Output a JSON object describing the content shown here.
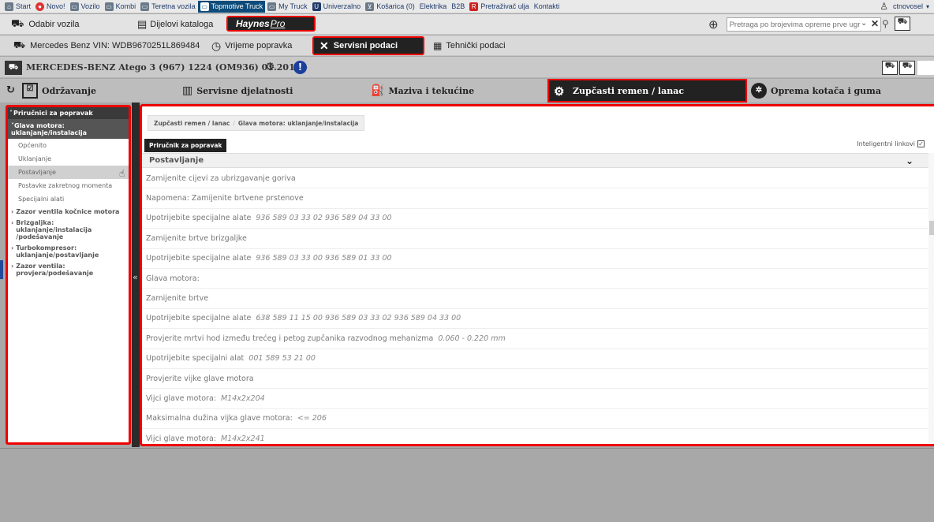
{
  "topnav": {
    "items": [
      "Start",
      "Novo!",
      "Vozilo",
      "Kombi",
      "Teretna vozila",
      "Topmotive Truck",
      "My Truck",
      "Univerzalno",
      "Košarica (0)",
      "Elektrika",
      "B2B",
      "Pretraživač ulja",
      "Kontakti"
    ],
    "active_index": 5,
    "user": "ctnovosel"
  },
  "row2": {
    "odabir": "Odabir vozila",
    "dijelovi": "Dijelovi kataloga",
    "haynes": "Haynes",
    "haynes_pro": "Pro",
    "search_placeholder": "Pretraga po brojevima opreme prve ugr"
  },
  "row3": {
    "vin": "Mercedes Benz VIN: WDB9670251L869484",
    "vrijeme": "Vrijeme popravka",
    "servisni": "Servisni podaci",
    "tehnicki": "Tehnički podaci"
  },
  "vehicle": {
    "title": "MERCEDES-BENZ Atego 3 (967) 1224 (OM936) 01.2013 -",
    "alert": "!"
  },
  "tabs": {
    "odrzavanje": "Održavanje",
    "servisne": "Servisne djelatnosti",
    "maziva": "Maziva i tekućine",
    "zupcasti": "Zupčasti remen / lanac",
    "oprema": "Oprema kotača i guma"
  },
  "sidebar": {
    "header": "Priručnici za popravak",
    "group": "Glava motora: uklanjanje/instalacija",
    "items": [
      "Općenito",
      "Uklanjanje",
      "Postavljanje",
      "Postavke zakretnog momenta",
      "Specijalni alati"
    ],
    "active_index": 2,
    "closed": [
      "Zazor ventila kočnice motora",
      "Brizgaljka: uklanjanje/instalacija /podešavanje",
      "Turbokompresor: uklanjanje/postavljanje",
      "Zazor ventila: provjera/podešavanje"
    ]
  },
  "main": {
    "crumb1": "Zupčasti remen / lanac",
    "crumb_sep": "/",
    "crumb2": "Glava motora: uklanjanje/instalacija",
    "tab": "Priručnik za popravak",
    "smart_links": "Inteligentni linkovi",
    "section": "Postavljanje",
    "rows": [
      {
        "text": "Zamijenite cijevi za ubrizgavanje goriva",
        "value": ""
      },
      {
        "text": "Napomena: Zamijenite brtvene prstenove",
        "value": ""
      },
      {
        "text": "Upotrijebite specijalne alate",
        "value": "936 589 03 33 02  936 589 04 33 00"
      },
      {
        "text": "Zamijenite brtve brizgaljke",
        "value": ""
      },
      {
        "text": "Upotrijebite specijalne alate",
        "value": "936 589 03 33 00  936 589 01 33 00"
      },
      {
        "text": "Glava motora:",
        "value": ""
      },
      {
        "text": "Zamijenite brtve",
        "value": ""
      },
      {
        "text": "Upotrijebite specijalne alate",
        "value": "638 589 11 15 00  936 589 03 33 02  936 589 04 33 00"
      },
      {
        "text": "Provjerite mrtvi hod između trećeg i petog zupčanika razvodnog mehanizma",
        "value": "0.060 - 0.220 mm"
      },
      {
        "text": "Upotrijebite specijalni alat",
        "value": "001 589 53 21 00"
      },
      {
        "text": "Provjerite vijke glave motora",
        "value": ""
      },
      {
        "text": "Vijci glave motora:",
        "value": "M14x2x204"
      },
      {
        "text": "Maksimalna dužina vijka glave motora:",
        "value": "<= 206"
      },
      {
        "text": "Vijci glave motora:",
        "value": "M14x2x241"
      }
    ]
  }
}
